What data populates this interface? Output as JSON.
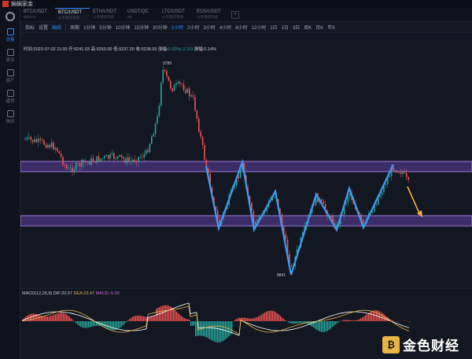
{
  "brand": "蜗蜗家金",
  "sidebar": {
    "items": [
      {
        "label": "交易",
        "icon": "trade-icon",
        "active": true
      },
      {
        "label": "资讯",
        "icon": "news-icon",
        "active": false
      },
      {
        "label": "资产",
        "icon": "assets-icon",
        "active": false
      },
      {
        "label": "借贷",
        "icon": "loan-icon",
        "active": false
      },
      {
        "label": "快讯",
        "icon": "flash-icon",
        "active": false
      }
    ]
  },
  "tabs": [
    {
      "pair": "BTC/USDT",
      "sub": "BitFinex",
      "active": false
    },
    {
      "pair": "BTC/USDT",
      "sub": "火币现货市场",
      "active": true
    },
    {
      "pair": "ETH/USDT",
      "sub": "火币现货市场",
      "active": false
    },
    {
      "pair": "USDT/QC",
      "sub": "ZB",
      "active": false
    },
    {
      "pair": "LTC/USDT",
      "sub": "火币现货市场",
      "active": false
    },
    {
      "pair": "EOS/USDT",
      "sub": "火币现货市场",
      "active": false
    }
  ],
  "toolbar": {
    "indicator": "指标",
    "settings": "设置",
    "draw": "画线",
    "period": "周期",
    "intervals": [
      "1分钟",
      "5分钟",
      "10分钟",
      "15分钟",
      "30分钟",
      "1小时",
      "2小时",
      "3小时",
      "4小时",
      "6小时",
      "12小时",
      "1日",
      "2日",
      "3日",
      "周K",
      "月K",
      "年K"
    ],
    "active_interval": "1小时"
  },
  "info": {
    "time": "时间:2020-07-02 11:00",
    "open": "开:9241.03",
    "high": "高:9250.00",
    "low": "低:9237.20",
    "close": "收:9238.93",
    "change_label": "涨幅:",
    "change_value": "0.02%(-2.10)",
    "amplitude": "振幅:0.14%"
  },
  "chart": {
    "high_label": "9785",
    "low_label": "8841"
  },
  "macd": {
    "name": "MACD(12,26,9)",
    "dif": "DIF:20.97",
    "dea": "DEA:23.47",
    "macd": "MACD:-5.00"
  },
  "colors": {
    "up": "#26a69a",
    "down": "#ef5350",
    "zone_fill": "#3c2d69",
    "zone_border": "#9e7ad6",
    "wave": "#3d9bf0",
    "arrow": "#f2b43c",
    "accent": "#2f8dff"
  },
  "watermark": {
    "icon": "jinse-logo-icon",
    "text": "金色财经"
  }
}
